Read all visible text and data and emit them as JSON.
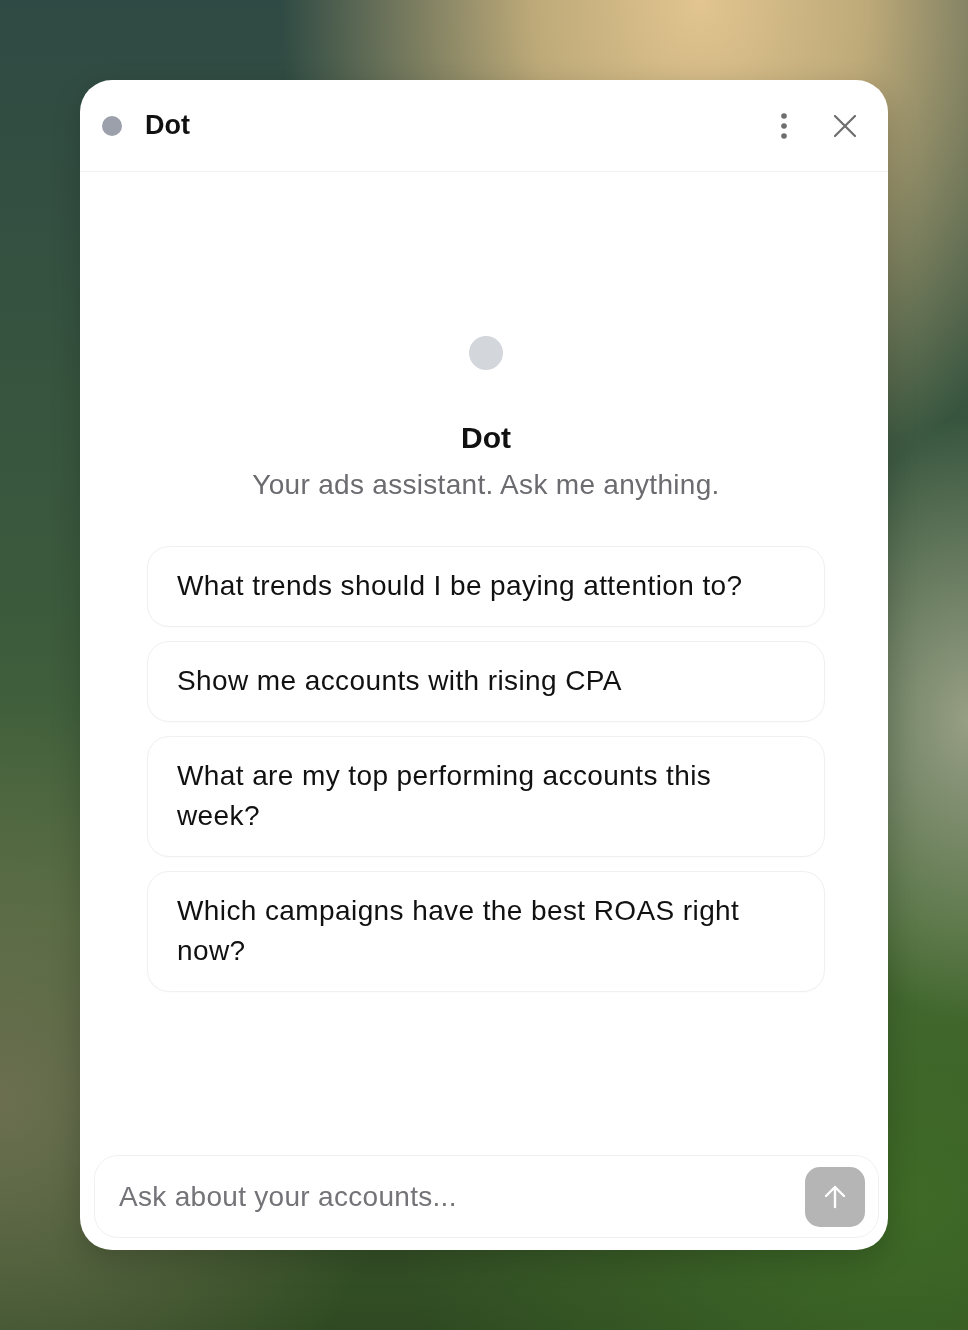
{
  "header": {
    "title": "Dot"
  },
  "welcome": {
    "title": "Dot",
    "subtitle": "Your ads assistant. Ask me anything."
  },
  "suggestions": [
    {
      "text": "What trends should I be paying attention to?"
    },
    {
      "text": "Show me accounts with rising CPA"
    },
    {
      "text": "What are my top performing accounts this week?"
    },
    {
      "text": "Which campaigns have the best ROAS right now?"
    }
  ],
  "composer": {
    "placeholder": "Ask about your accounts...",
    "send_disabled": true
  }
}
